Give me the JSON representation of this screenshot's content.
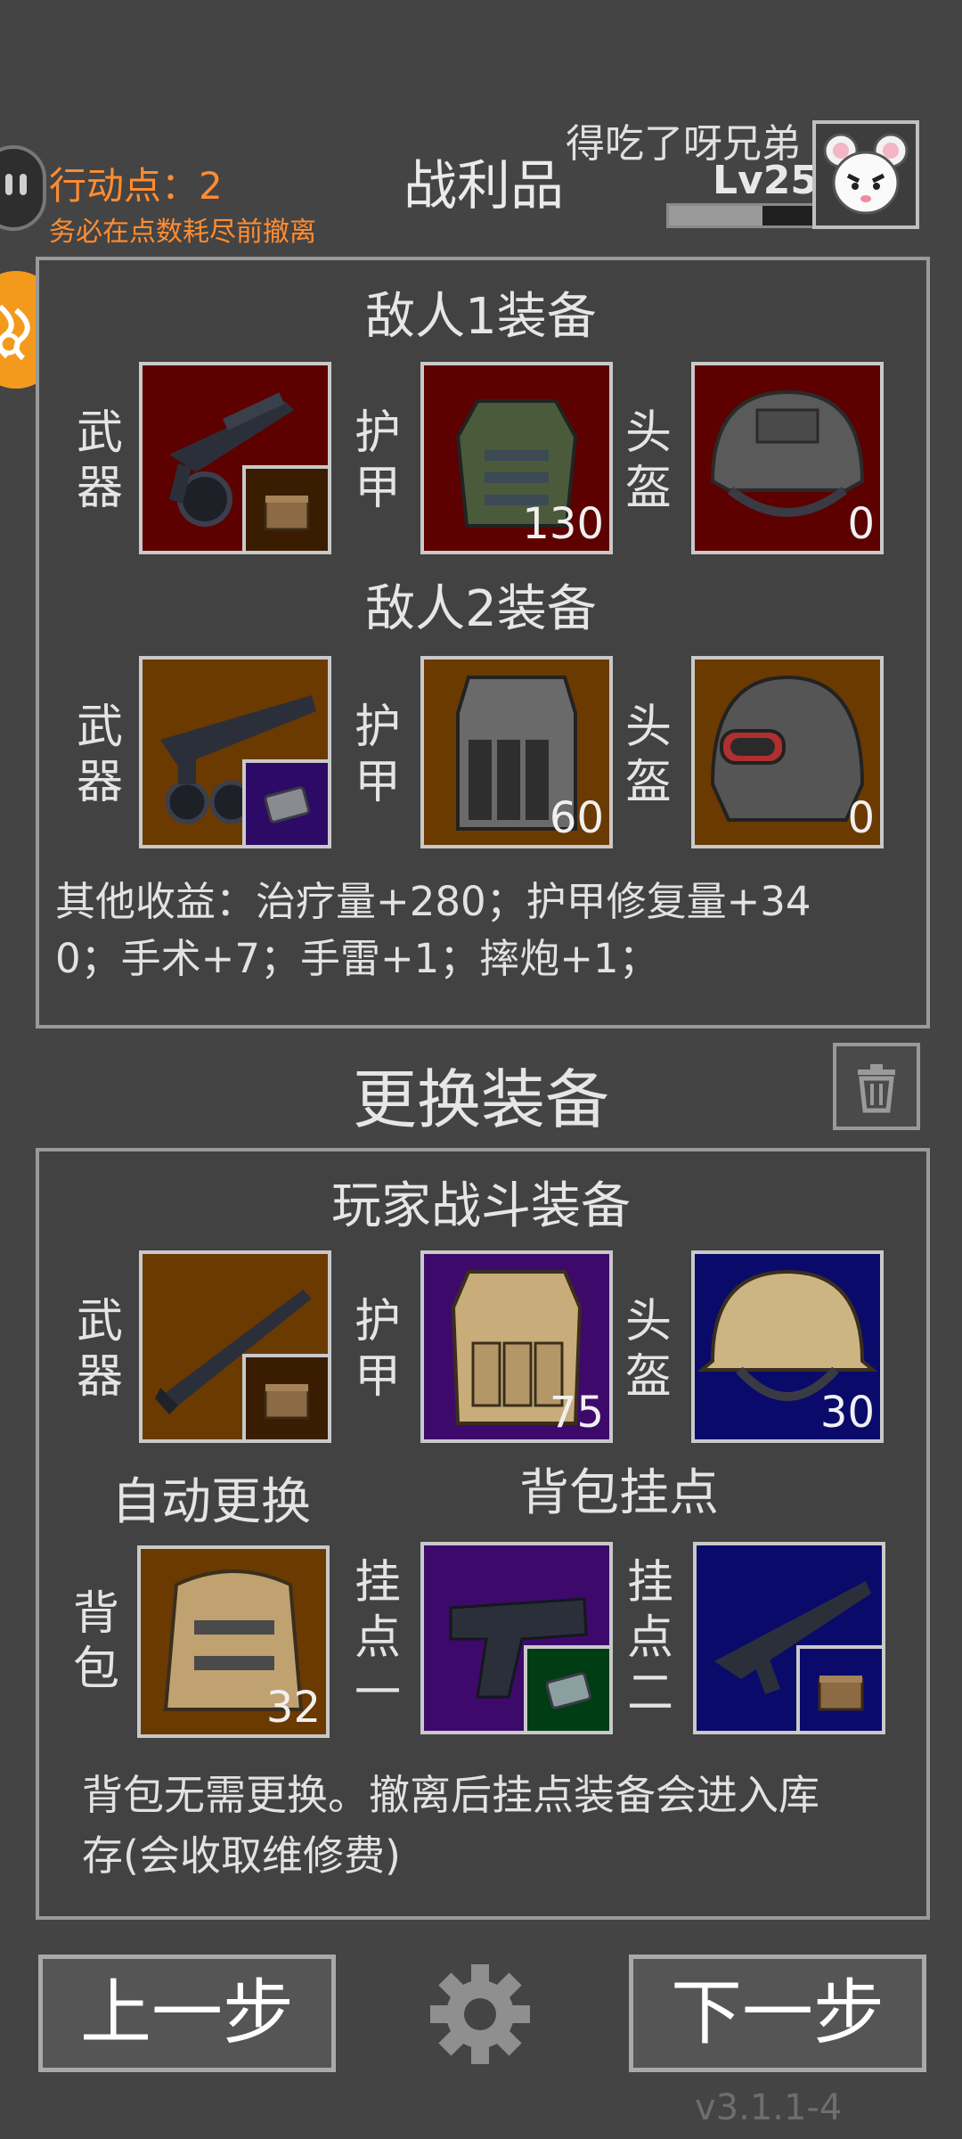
{
  "header": {
    "action_points": "行动点：2",
    "warning": "务必在点数耗尽前撤离",
    "title": "战利品",
    "nickname": "得吃了呀兄弟",
    "level": "Lv25",
    "xp_progress": 0.65
  },
  "loot": {
    "enemy1_title": "敌人1装备",
    "enemy2_title": "敌人2装备",
    "labels": {
      "weapon": [
        "武",
        "器"
      ],
      "armor": [
        "护",
        "甲"
      ],
      "helmet": [
        "头",
        "盔"
      ]
    },
    "enemy1": {
      "armor_value": "130",
      "helmet_value": "0"
    },
    "enemy2": {
      "armor_value": "60",
      "helmet_value": "0"
    },
    "other_income_line1": "其他收益：治疗量+280；护甲修复量+34",
    "other_income_line2": "0；手术+7；手雷+1；摔炮+1；"
  },
  "change": {
    "title": "更换装备",
    "player_title": "玩家战斗装备",
    "player": {
      "armor_value": "75",
      "helmet_value": "30",
      "backpack_value": "32"
    },
    "auto_replace": "自动更换",
    "backpack_mounts": "背包挂点",
    "backpack_label": [
      "背",
      "包"
    ],
    "mount1_label": [
      "挂",
      "点",
      "一"
    ],
    "mount2_label": [
      "挂",
      "点",
      "二"
    ],
    "note_line1": "背包无需更换。撤离后挂点装备会进入库",
    "note_line2": "存(会收取维修费)"
  },
  "footer": {
    "prev": "上一步",
    "next": "下一步",
    "version": "v3.1.1-4"
  },
  "colors": {
    "accent_orange": "#ff8c32",
    "rarity_red": "#5c0000",
    "rarity_brown": "#6b3a00",
    "rarity_purple": "#3d0a6b",
    "rarity_navy": "#0a0a6b"
  },
  "icons": {
    "enemy1": [
      "sniper-rifle-icon",
      "ammo-box-icon",
      "tactical-vest-icon",
      "combat-helmet-icon"
    ],
    "enemy2": [
      "light-machine-gun-icon",
      "magazine-icon",
      "plate-carrier-icon",
      "visor-helmet-icon"
    ],
    "player": [
      "shotgun-icon",
      "ammo-box-icon",
      "tan-plate-carrier-icon",
      "tan-helmet-icon",
      "tan-backpack-icon",
      "pistol-icon",
      "magazine-icon",
      "assault-rifle-icon",
      "ammo-box-icon"
    ],
    "ui": [
      "gear-icon",
      "trash-icon",
      "avatar-icon"
    ]
  }
}
